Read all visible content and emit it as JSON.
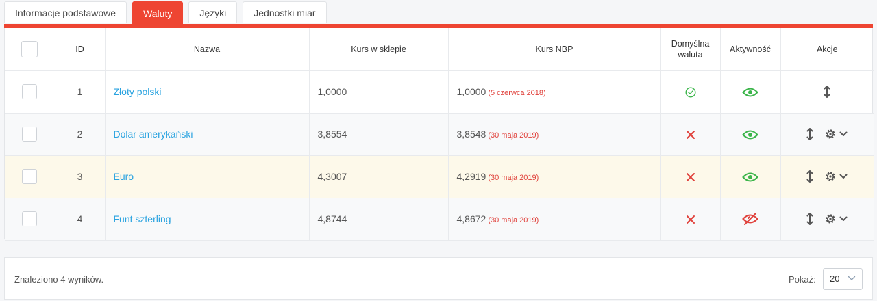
{
  "tabs": [
    {
      "label": "Informacje podstawowe",
      "active": false
    },
    {
      "label": "Waluty",
      "active": true
    },
    {
      "label": "Języki",
      "active": false
    },
    {
      "label": "Jednostki miar",
      "active": false
    }
  ],
  "table": {
    "headers": {
      "id": "ID",
      "name": "Nazwa",
      "shop_rate": "Kurs w sklepie",
      "nbp_rate": "Kurs NBP",
      "default_currency_line1": "Domyślna",
      "default_currency_line2": "waluta",
      "activity": "Aktywność",
      "actions": "Akcje"
    },
    "rows": [
      {
        "id": "1",
        "name": "Złoty polski",
        "shop_rate": "1,0000",
        "nbp_rate": "1,0000",
        "nbp_date": "(5 czerwca 2018)",
        "default": true,
        "active": true,
        "gear": false
      },
      {
        "id": "2",
        "name": "Dolar amerykański",
        "shop_rate": "3,8554",
        "nbp_rate": "3,8548",
        "nbp_date": "(30 maja 2019)",
        "default": false,
        "active": true,
        "gear": true
      },
      {
        "id": "3",
        "name": "Euro",
        "shop_rate": "4,3007",
        "nbp_rate": "4,2919",
        "nbp_date": "(30 maja 2019)",
        "default": false,
        "active": true,
        "gear": true
      },
      {
        "id": "4",
        "name": "Funt szterling",
        "shop_rate": "4,8744",
        "nbp_rate": "4,8672",
        "nbp_date": "(30 maja 2019)",
        "default": false,
        "active": false,
        "gear": true
      }
    ]
  },
  "footer": {
    "found_text": "Znaleziono 4 wyników.",
    "show_label": "Pokaż:",
    "per_page": "20"
  },
  "colors": {
    "accent": "#ee4532",
    "link": "#2aa3e0",
    "success": "#3bb54a",
    "danger": "#e0413b",
    "highlight_row": "#fdf9ea"
  },
  "icons": {
    "default_yes": "check-circle-icon",
    "default_no": "x-icon",
    "active_yes": "eye-icon",
    "active_no": "eye-slash-icon",
    "move": "vertical-arrows-icon",
    "settings": "gear-icon",
    "menu": "chevron-down-icon"
  }
}
